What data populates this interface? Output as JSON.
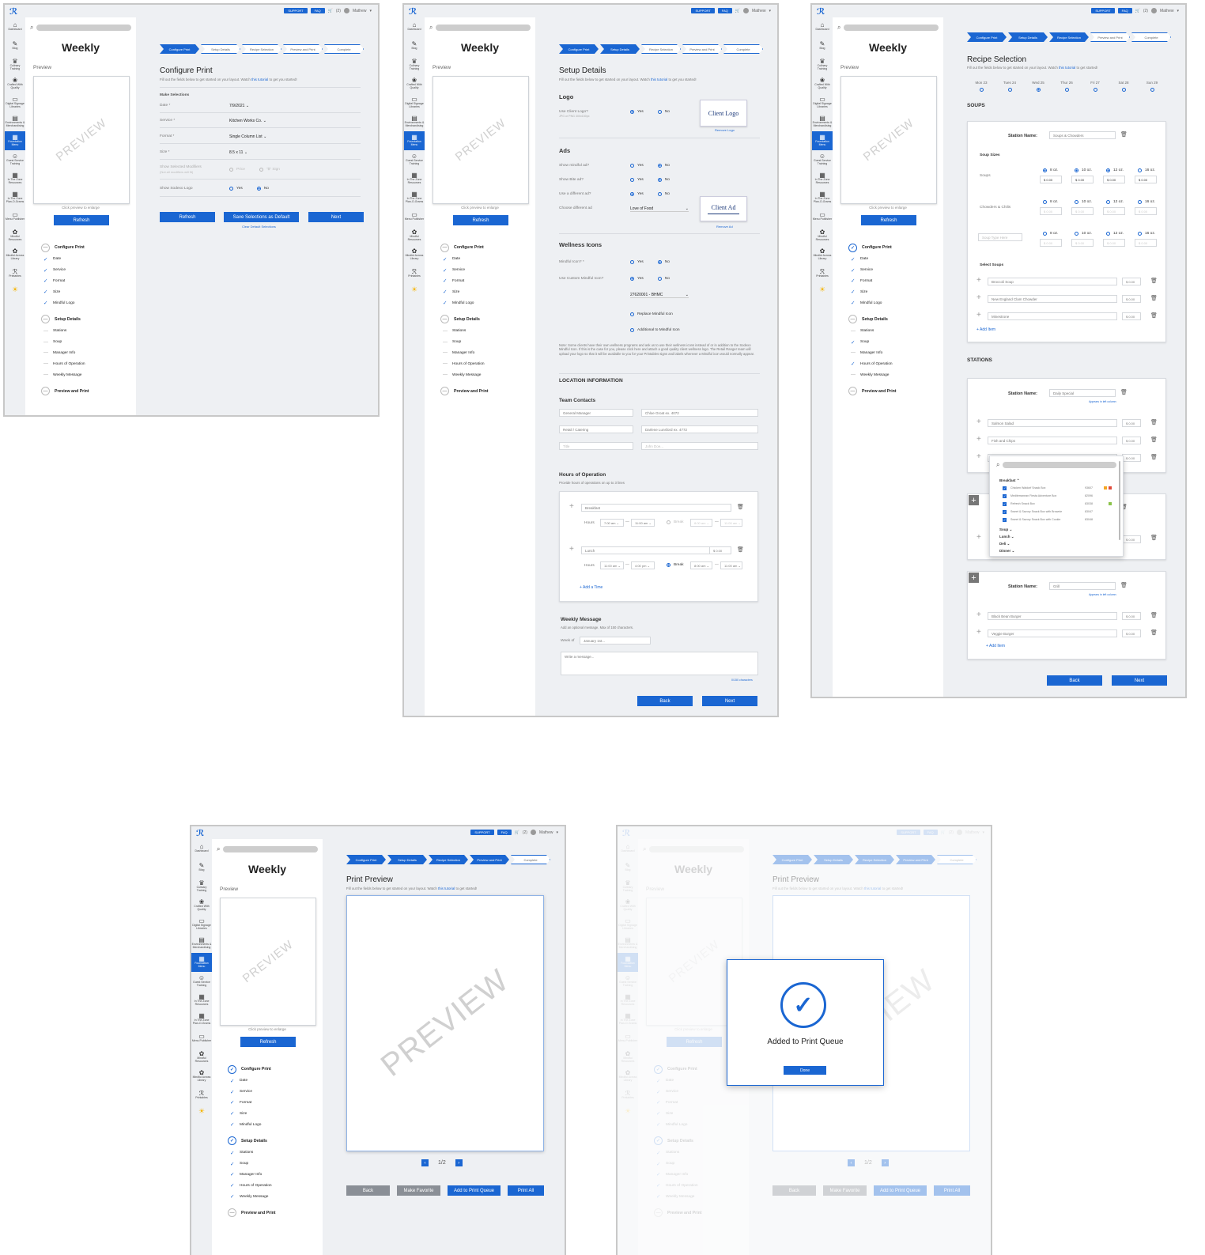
{
  "app": {
    "support_label": "SUPPORT",
    "faq_label": "FAQ",
    "notif_count": "(2)",
    "user_name": "Mathew",
    "panel_title": "Weekly",
    "preview_label": "Preview",
    "preview_watermark": "PREVIEW",
    "click_enlarge": "Click preview to enlarge",
    "refresh_label": "Refresh",
    "nav_items": [
      "Dashboard",
      "Blog",
      "Culinary Training",
      "Crafted With Quality",
      "Digital Signage Libraries",
      "Environments & Merchandising",
      "Foundation Menu",
      "Guest Service Training",
      "In The Zone Resources",
      "In The Zone Plan-O-Grams",
      "Menu Publisher",
      "Mindful Resources",
      "Mindful Across Library",
      "Printables"
    ],
    "tabs": [
      "Configure Print",
      "Setup Details",
      "Recipe Selection",
      "Preview and Print",
      "Complete"
    ],
    "steps": {
      "configure": "Configure Print",
      "configure_items": [
        "Date",
        "Service",
        "Format",
        "Size",
        "Mindful Logo"
      ],
      "setup": "Setup Details",
      "setup_items": [
        "Stations",
        "Soup",
        "Manager Info",
        "Hours of Operation",
        "Weekly Message"
      ],
      "preview": "Preview and Print"
    },
    "fill_prefix": "Fill out the fields below to get started on your layout. Watch ",
    "tutorial_link": "this tutorial",
    "fill_suffix": " to get you started!",
    "fill_suffix2": " to get started!"
  },
  "s1": {
    "title": "Configure Print",
    "make_selections": "Make Selections",
    "fields": [
      {
        "label": "Date *",
        "value": "7/9/2021"
      },
      {
        "label": "Service *",
        "value": "Kitchen Works Co."
      },
      {
        "label": "Format *",
        "value": "Single Column List"
      },
      {
        "label": "Size *",
        "value": "8.5 x 11"
      }
    ],
    "modifiers_label": "Show Selected Modifiers",
    "modifiers_sub": "(Not all modifiers will fit)",
    "modifiers_opts": [
      "Price",
      "\"$\" Sign"
    ],
    "sodexo_label": "Show Sodexo Logo",
    "yes": "Yes",
    "no": "No",
    "refresh": "Refresh",
    "save_default": "Save Selections as Default",
    "clear_default": "Clear Default Selections",
    "next": "Next"
  },
  "s2": {
    "title": "Setup Details",
    "logo_h": "Logo",
    "use_client_logo": "Use Client Logo?",
    "logo_hint": "JPG or PNG 300x150px",
    "client_logo": "Client Logo",
    "remove_logo": "Remove Logo",
    "ads_h": "Ads",
    "ads_q": [
      "Show mindful ad?",
      "Show Bite ad?",
      "Use a different ad?"
    ],
    "choose_ad": "Choose different ad",
    "ad_value": "Love of Food",
    "client_ad": "Client Ad",
    "remove_ad": "Remove Ad",
    "wellness_h": "Wellness Icons",
    "mindful_icon_q": "Mindful Icon? *",
    "custom_icon_q": "Use Custom Mindful Icon?",
    "icon_value": "27620001 - BHMC",
    "replace_icon": "Replace Mindful Icon",
    "additional_icon": "Additional to Mindful Icon",
    "note": "Note: Some clients have their own wellness programs and ask us to use their wellness icons instead of or in addition to the Sodexo Mindful Icon. If this is the case for you, please click here and attach a good quality client wellness logo. The Retail Ranger team will upload your logo so that it will be available to you for your Printables signs and labels wherever a Mindful icon would normally appear.",
    "location_h": "LOCATION INFORMATION",
    "team_h": "Team Contacts",
    "contacts": [
      {
        "role": "General Manager",
        "name": "Chloe Groat ex. 4072"
      },
      {
        "role": "Retail / Catering",
        "name": "Darlene Lunsford ex. 4772"
      },
      {
        "role": "Title",
        "name": "John Doe..."
      }
    ],
    "hours_h": "Hours of Operation",
    "hours_sub": "Provide hours of operations on up to 3 lines",
    "hours": [
      {
        "name": "Breakfast",
        "price": "",
        "from": "7:00 am",
        "to": "11:00 am",
        "break_from": "8:00 am",
        "break_to": "11:00 am",
        "break_on": false
      },
      {
        "name": "Lunch",
        "price": "$ 0.00",
        "from": "11:00 am",
        "to": "4:00 pm",
        "break_from": "8:00 am",
        "break_to": "11:00 am",
        "break_on": true
      }
    ],
    "hours_label": "Hours",
    "break_label": "Break",
    "add_time": "+ Add a Time",
    "weekly_h": "Weekly Message",
    "weekly_sub": "Add an optional message. Max of 150 characters.",
    "week_of": "Week of",
    "week_ph": "January 1st...",
    "msg_ph": "Write a message...",
    "char_count": "0/150 characters",
    "back": "Back",
    "next": "Next",
    "yes": "Yes",
    "no": "No"
  },
  "s3": {
    "title": "Recipe Selection",
    "days": [
      "Mon 23",
      "Tues 24",
      "Wed 25",
      "Thur 26",
      "Fri 27",
      "Sat 28",
      "Sun 29"
    ],
    "selected_day": "Wed 25",
    "soups_h": "SOUPS",
    "station_name_label": "Station Name:",
    "soup_station": "Soups & Chowders",
    "soup_sizes": "Soup Sizes",
    "size_rows": [
      {
        "label": "Soups",
        "sizes": [
          "8 oz.",
          "10 oz.",
          "12 oz.",
          "16 oz."
        ],
        "prices": [
          "$ 0.00",
          "$ 0.00",
          "$ 0.00",
          "$ 0.00"
        ]
      },
      {
        "label": "Chowders & Chilis",
        "sizes": [
          "8 oz.",
          "10 oz.",
          "12 oz.",
          "16 oz."
        ],
        "prices": [
          "$ 0.00",
          "$ 0.00",
          "$ 0.00",
          "$ 0.00"
        ]
      },
      {
        "label": "Soup Type Here",
        "sizes": [
          "8 oz.",
          "10 oz.",
          "12 oz.",
          "16 oz."
        ],
        "prices": [
          "$ 0.00",
          "$ 0.00",
          "$ 0.00",
          "$ 0.00"
        ]
      }
    ],
    "select_soups": "Select Soups",
    "soups": [
      {
        "name": "Broccoli Soup",
        "price": "$ 0.00"
      },
      {
        "name": "New England Clam Chowder",
        "price": "$ 0.00"
      },
      {
        "name": "Minestrone",
        "price": "$ 0.00"
      }
    ],
    "add_item": "+ Add Item",
    "stations_h": "STATIONS",
    "station1": "Daily Special",
    "appears_left": "Appears in left column",
    "station1_items": [
      {
        "name": "Salmon Salad",
        "price": "$ 0.00"
      },
      {
        "name": "Fish and Chips",
        "price": "$ 0.00"
      },
      {
        "name": "",
        "price": "$ 0.00"
      }
    ],
    "dropdown": {
      "group": "Breakfast",
      "items": [
        {
          "name": "Chicken Waldorf Snack Box",
          "code": "93607"
        },
        {
          "name": "Mediterranean Fiesta Adventure Box",
          "code": "82096"
        },
        {
          "name": "Refresh Snack Box",
          "code": "83038"
        },
        {
          "name": "Sweet & Savory Snack Box with Brownie",
          "code": "83047"
        },
        {
          "name": "Sweet & Savory Snack Box with Cookie",
          "code": "83048"
        }
      ],
      "others": [
        "Soup",
        "Lunch",
        "Deli",
        "Dinner"
      ]
    },
    "station3": "Grill",
    "station3_items": [
      {
        "name": "Black Bean Burger",
        "price": "$ 0.00"
      },
      {
        "name": "Veggie Burger",
        "price": "$ 0.00"
      }
    ],
    "back": "Back",
    "next": "Next"
  },
  "s4": {
    "title": "Print Preview",
    "page": "1/2",
    "back": "Back",
    "make_favorite": "Make Favorite",
    "add_queue": "Add to Print Queue",
    "print_all": "Print All"
  },
  "s5": {
    "modal_title": "Added to Print Queue",
    "done": "Done"
  },
  "colors": {
    "accent": "#1a66d2"
  }
}
